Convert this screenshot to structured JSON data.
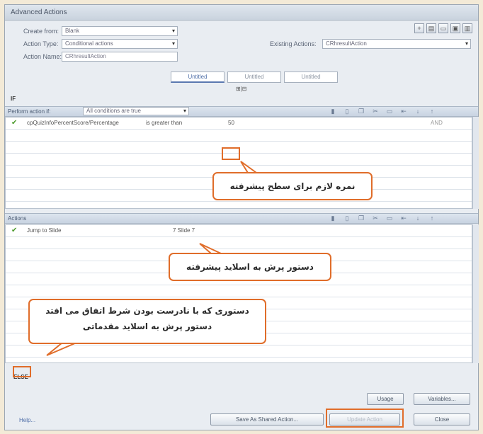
{
  "window": {
    "title": "Advanced Actions"
  },
  "form": {
    "create_from_label": "Create from:",
    "create_from_value": "Blank",
    "action_type_label": "Action Type:",
    "action_type_value": "Conditional actions",
    "action_name_label": "Action Name:",
    "action_name_value": "CRhresultAction",
    "existing_label": "Existing Actions:",
    "existing_value": "CRhresultAction"
  },
  "tabs": [
    "Untitled",
    "Untitled",
    "Untitled"
  ],
  "small_buttons": "⊞|⊟",
  "if_label": "IF",
  "condition_section": {
    "label": "Perform action if:",
    "combo_value": "All conditions are true",
    "row": {
      "variable": "cpQuizInfoPercentScore/Percentage",
      "operator": "is greater than",
      "value": "50",
      "trailing": "AND"
    }
  },
  "actions_section": {
    "label": "Actions",
    "row": {
      "command": "Jump to Slide",
      "target": "7 Slide 7"
    }
  },
  "else_label": "ELSE",
  "buttons": {
    "usage": "Usage",
    "variables": "Variables...",
    "help": "Help...",
    "save_shared": "Save As Shared Action...",
    "update": "Update Action",
    "close": "Close"
  },
  "callouts": {
    "score": "نمره لازم برای سطح پیشرفته",
    "jump_advanced": "دستور پرش به اسلاید پیشرفته",
    "else_line1": "دستوری که با نادرست بودن شرط اتفاق می افتد",
    "else_line2": "دستور پرش به اسلاید مقدماتی"
  },
  "colors": {
    "accent": "#e06d2a",
    "window": "#e9edf2",
    "header": "#c8d3e1"
  }
}
